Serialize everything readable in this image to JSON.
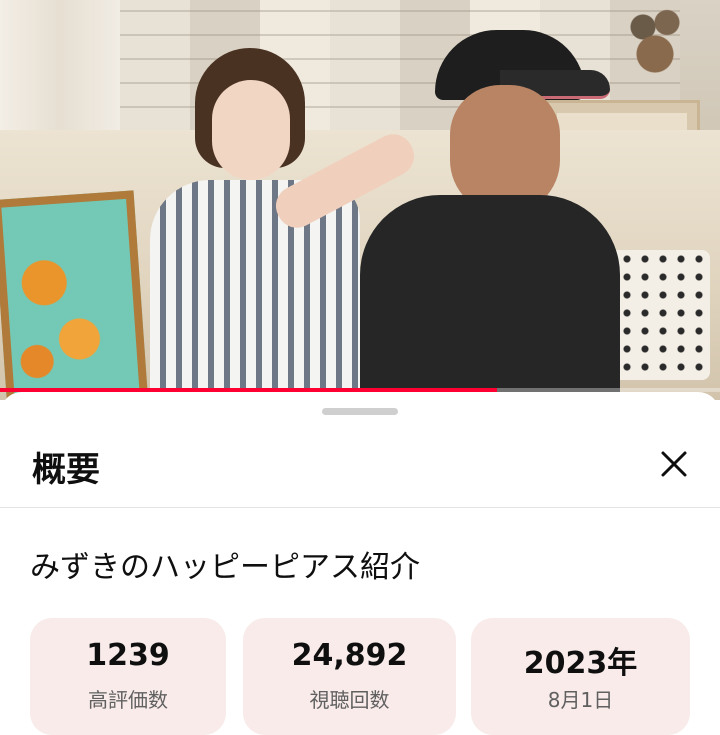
{
  "video": {
    "progress": 0.69
  },
  "sheet": {
    "heading": "概要",
    "close_icon": "close-icon",
    "video_title": "みずきのハッピーピアス紹介",
    "stats": [
      {
        "value": "1239",
        "label": "高評価数"
      },
      {
        "value": "24,892",
        "label": "視聴回数"
      },
      {
        "value": "2023年",
        "label": "8月1日"
      }
    ]
  },
  "colors": {
    "progress": "#ff0033",
    "stat_bg": "#f8ebea",
    "label_grey": "#606060"
  }
}
